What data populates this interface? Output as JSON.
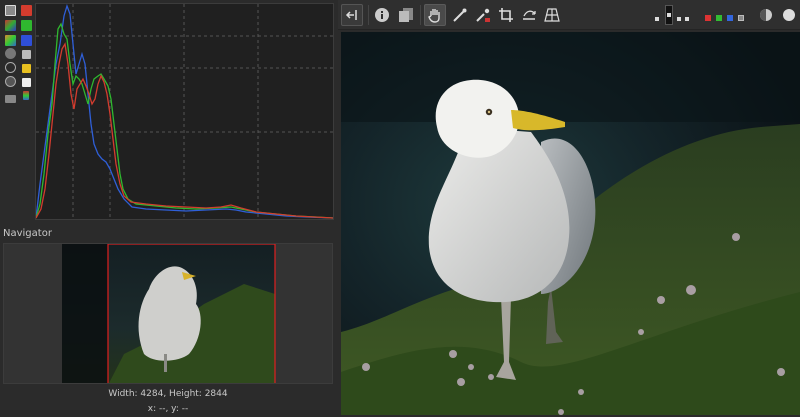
{
  "histogram": {
    "channels": [
      "red",
      "green",
      "blue"
    ],
    "colors": {
      "red": "#d33c2e",
      "green": "#2fb82f",
      "blue": "#2f5fd8",
      "background": "#202020",
      "grid": "#555555"
    },
    "toolbar_icons": [
      "histogram-full-icon",
      "red-channel-icon",
      "rgb-overlay-icon",
      "green-channel-icon",
      "color-picker-icon",
      "blue-channel-icon",
      "luminance-icon",
      "chroma-icon",
      "raw-histogram-icon",
      "yellow-channel-icon",
      "linear-log-icon",
      "white-channel-icon",
      "bar-icon",
      "display-icon"
    ]
  },
  "navigator": {
    "title": "Navigator",
    "size_text": "Width: 4284, Height: 2844",
    "coords_text": "x: --, y: --"
  },
  "toolbar": {
    "icons": [
      "panel-toggle-icon",
      "info-icon",
      "before-after-icon",
      "hand-pan-icon",
      "white-balance-picker-icon",
      "color-picker-icon",
      "crop-icon",
      "straighten-icon",
      "perspective-icon",
      "indicator-1-icon",
      "indicator-2-icon",
      "indicator-3-icon",
      "red-dot-icon",
      "green-dot-icon",
      "blue-dot-icon",
      "lum-dot-icon",
      "gray-dot-icon",
      "focus-mask-icon",
      "exposure-toggle-icon"
    ],
    "active": "hand-pan-icon"
  }
}
